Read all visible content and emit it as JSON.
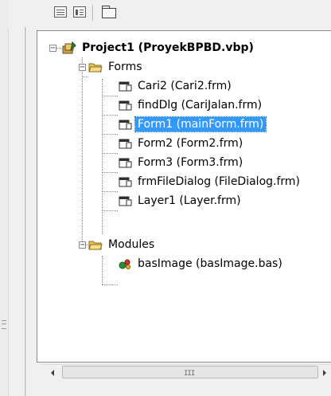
{
  "toolbar": {
    "buttons": [
      {
        "name": "view-code-button",
        "icon": "view-code-icon"
      },
      {
        "name": "view-object-button",
        "icon": "view-object-icon"
      },
      {
        "name": "toggle-folders-button",
        "icon": "folder-icon"
      }
    ]
  },
  "tree": {
    "project": {
      "label": "Project1 (ProyekBPBD.vbp)",
      "expander": "−",
      "icon": "project-icon"
    },
    "forms_folder": {
      "label": "Forms",
      "expander": "−",
      "icon": "folder-icon"
    },
    "forms": [
      {
        "label": "Cari2 (Cari2.frm)"
      },
      {
        "label": "findDlg (CariJalan.frm)"
      },
      {
        "label": "Form1 (mainForm.frm)",
        "selected": true
      },
      {
        "label": "Form2 (Form2.frm)"
      },
      {
        "label": "Form3 (Form3.frm)"
      },
      {
        "label": "frmFileDialog (FileDialog.frm)"
      },
      {
        "label": "Layer1 (Layer.frm)"
      }
    ],
    "modules_folder": {
      "label": "Modules",
      "expander": "−",
      "icon": "folder-icon"
    },
    "modules": [
      {
        "label": "basImage (basImage.bas)"
      }
    ]
  },
  "scrollbar": {
    "left_arrow": "◀",
    "right_arrow": "▶",
    "thumb_grip": "III"
  },
  "colors": {
    "selection": "#3399ff",
    "selection_text": "#ffffff",
    "panel_bg": "#ffffff",
    "chrome_bg": "#f0f0f0"
  }
}
